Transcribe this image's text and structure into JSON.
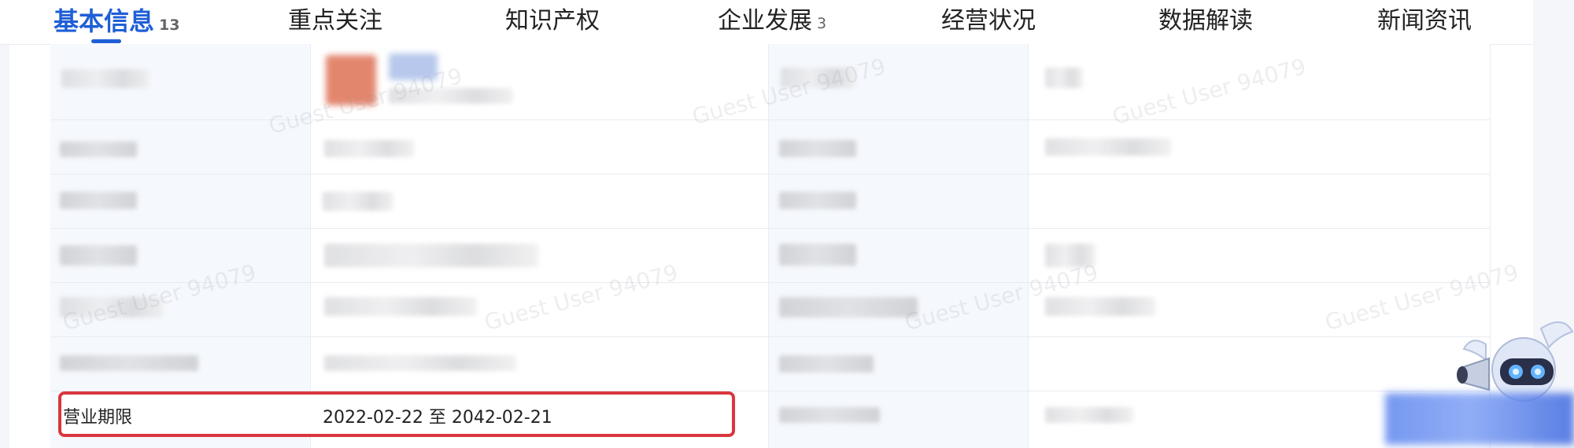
{
  "tabs": [
    {
      "label": "基本信息",
      "count": "13",
      "active": true
    },
    {
      "label": "重点关注",
      "count": "",
      "active": false
    },
    {
      "label": "知识产权",
      "count": "",
      "active": false
    },
    {
      "label": "企业发展",
      "count": "3",
      "active": false
    },
    {
      "label": "经营状况",
      "count": "",
      "active": false
    },
    {
      "label": "数据解读",
      "count": "",
      "active": false
    },
    {
      "label": "新闻资讯",
      "count": "",
      "active": false
    }
  ],
  "highlighted_row": {
    "label": "营业期限",
    "value": "2022-02-22 至 2042-02-21"
  },
  "watermark_text": "Guest User 94079",
  "colors": {
    "accent": "#1f5fd6",
    "highlight_border": "#d9363e"
  }
}
